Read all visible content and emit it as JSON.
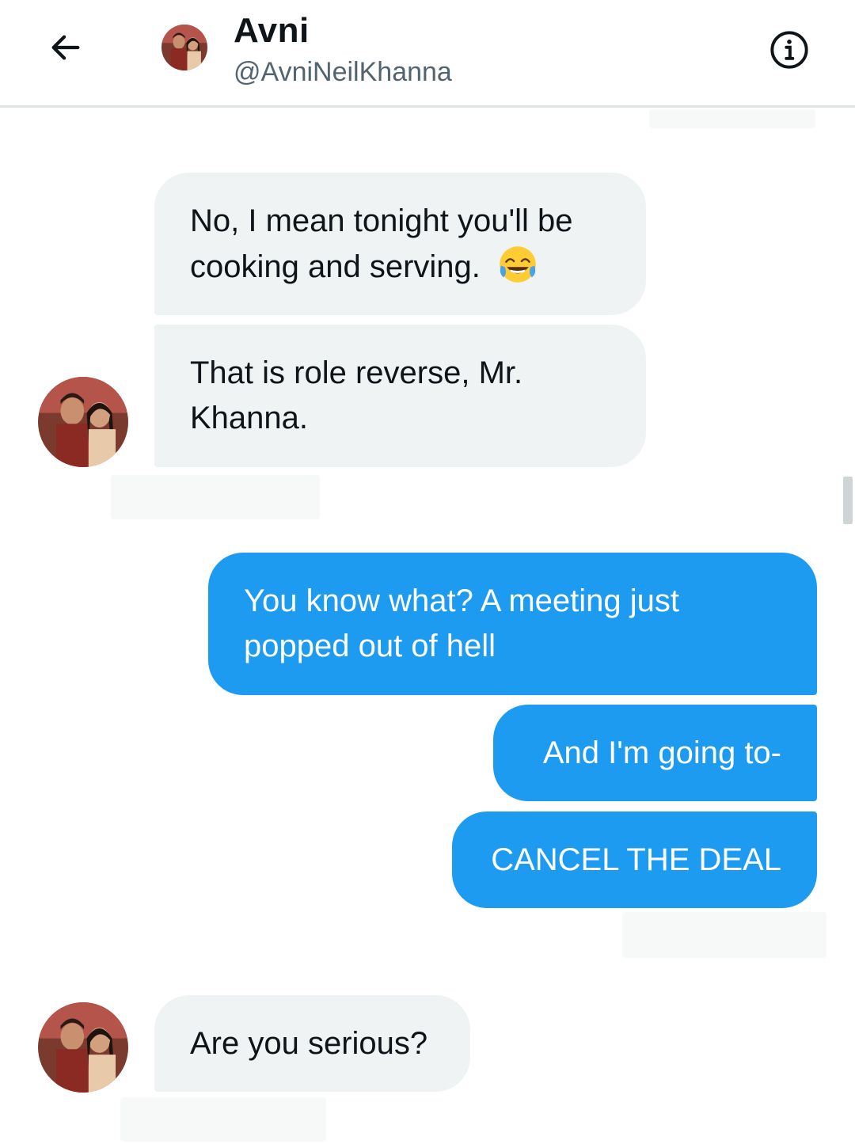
{
  "header": {
    "name": "Avni",
    "handle": "@AvniNeilKhanna"
  },
  "icons": {
    "back": "arrow-left-icon",
    "info": "info-circle-icon",
    "emoji": "face-with-tears-of-joy"
  },
  "messages": [
    {
      "from": "them",
      "lines": [
        "No, I mean tonight you'll be",
        "cooking and serving."
      ],
      "emoji": "😂"
    },
    {
      "from": "them",
      "lines": [
        "That is role reverse, Mr.",
        "Khanna."
      ]
    },
    {
      "from": "me",
      "lines": [
        "You know what? A meeting just",
        "popped out of hell"
      ]
    },
    {
      "from": "me",
      "lines": [
        "And I'm going to-"
      ]
    },
    {
      "from": "me",
      "lines": [
        "CANCEL THE DEAL"
      ]
    },
    {
      "from": "them",
      "lines": [
        "Are you serious?"
      ]
    }
  ],
  "colors": {
    "incoming_bubble": "#eff3f4",
    "outgoing_bubble": "#1d9bf0",
    "text_primary": "#0f1419",
    "text_secondary": "#536471"
  }
}
